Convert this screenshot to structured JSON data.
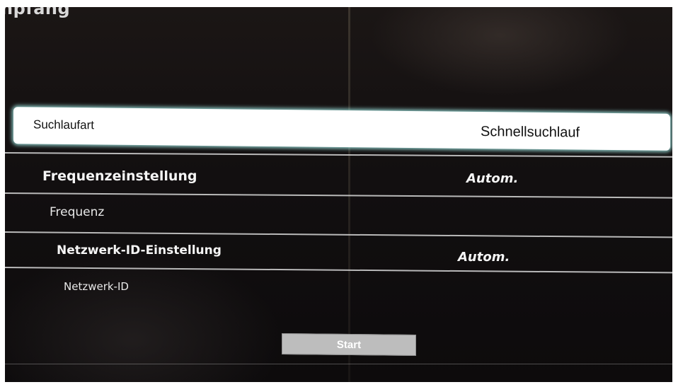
{
  "screen": {
    "title": "npfang"
  },
  "menu": {
    "items": [
      {
        "label": "Suchlaufart",
        "value": "Schnellsuchlauf",
        "selected": true
      },
      {
        "label": "Frequenzeinstellung",
        "value": "Autom."
      },
      {
        "label": "Frequenz",
        "value": ""
      },
      {
        "label": "Netzwerk-ID-Einstellung",
        "value": "Autom."
      },
      {
        "label": "Netzwerk-ID",
        "value": ""
      }
    ]
  },
  "actions": {
    "start_label": "Start"
  },
  "colors": {
    "background": "#120f10",
    "text": "#ffffff",
    "selected_background": "#ffffff",
    "selected_glow": "#a0e6e1",
    "button": "#bdbdbd"
  }
}
